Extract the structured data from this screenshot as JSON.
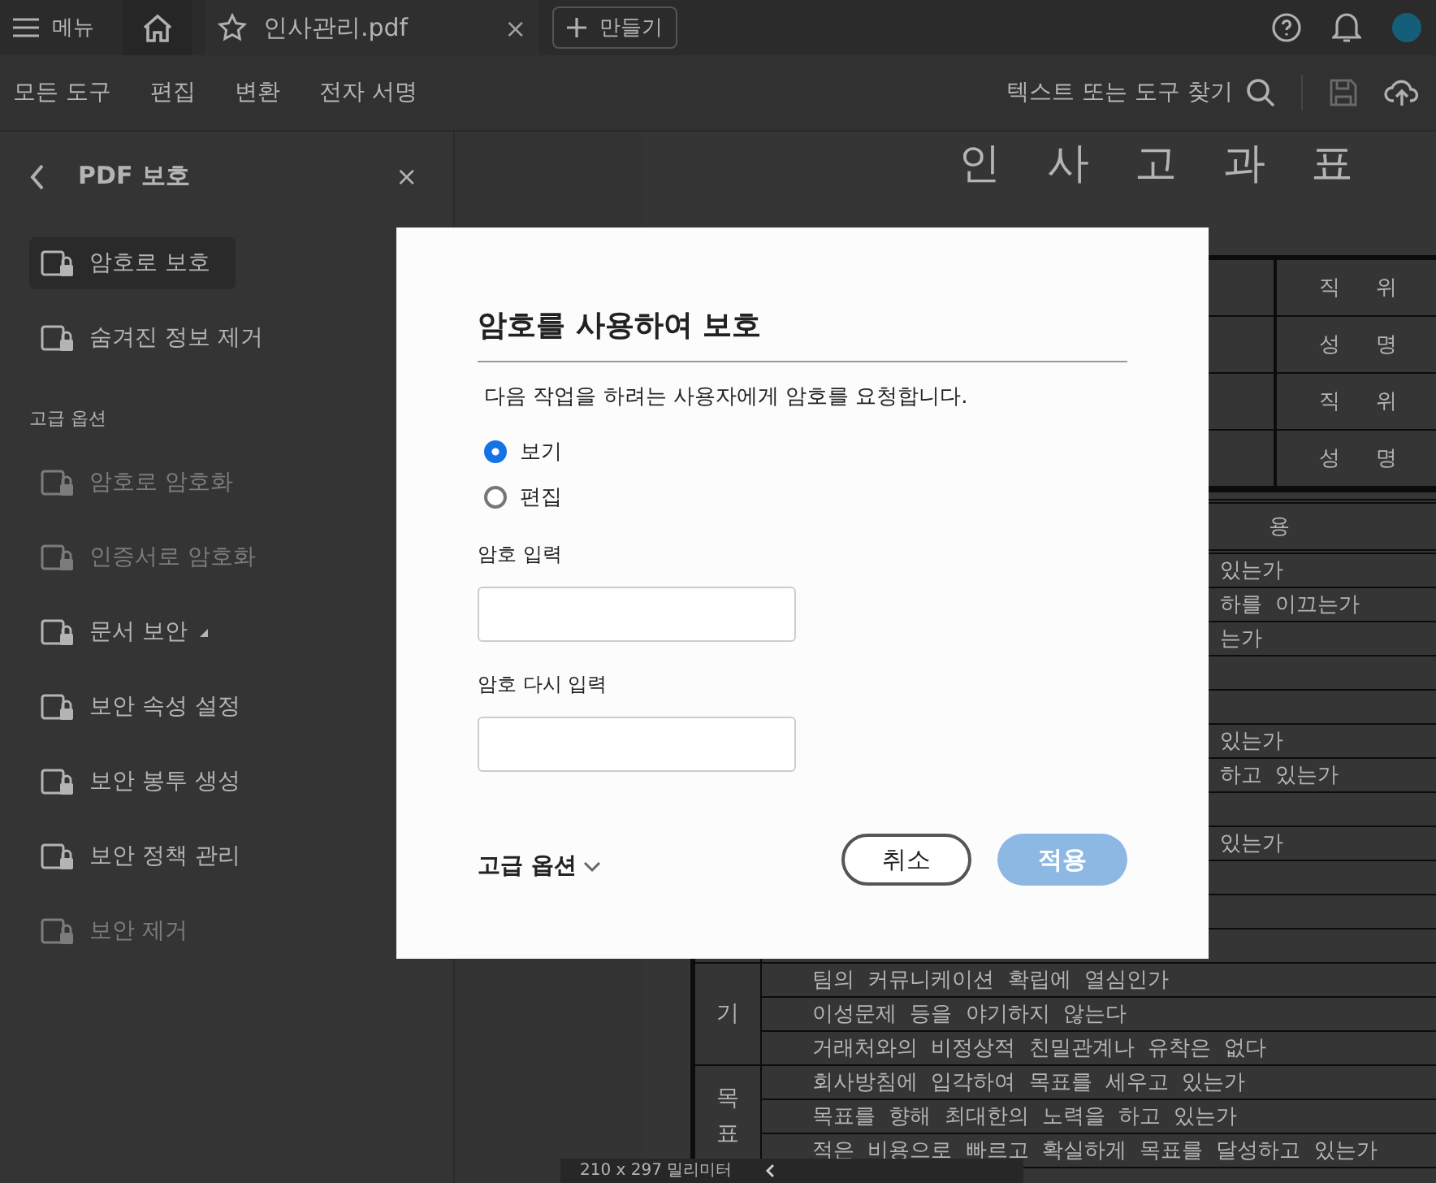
{
  "tab_bar": {
    "menu_label": "메뉴",
    "tab": {
      "label": "인사관리.pdf",
      "close": "×"
    },
    "create_button": "만들기"
  },
  "toolbar": {
    "items": [
      "모든 도구",
      "편집",
      "변환",
      "전자 서명"
    ],
    "search_placeholder": "텍스트 또는 도구 찾기"
  },
  "sidebar": {
    "title": "PDF 보호",
    "close": "×",
    "items": [
      {
        "label": "암호로 보호",
        "selected": true,
        "disabled": false,
        "submenu": false
      },
      {
        "label": "숨겨진 정보 제거",
        "selected": false,
        "disabled": false,
        "submenu": false
      }
    ],
    "section_label": "고급 옵션",
    "advanced_items": [
      {
        "label": "암호로 암호화",
        "selected": false,
        "disabled": true,
        "submenu": false
      },
      {
        "label": "인증서로 암호화",
        "selected": false,
        "disabled": true,
        "submenu": false
      },
      {
        "label": "문서 보안",
        "selected": false,
        "disabled": false,
        "submenu": true
      },
      {
        "label": "보안 속성 설정",
        "selected": false,
        "disabled": false,
        "submenu": false
      },
      {
        "label": "보안 봉투 생성",
        "selected": false,
        "disabled": false,
        "submenu": false
      },
      {
        "label": "보안 정책 관리",
        "selected": false,
        "disabled": false,
        "submenu": false
      },
      {
        "label": "보안 제거",
        "selected": false,
        "disabled": true,
        "submenu": false
      }
    ]
  },
  "document": {
    "title": "인 사 고 과 표",
    "sign_rows": [
      "직 위",
      "성 명",
      "직 위",
      "성 명"
    ],
    "content_header": "용",
    "groups": [
      {
        "rows": [
          {
            "kind": "cut",
            "text": "있는가"
          },
          {
            "kind": "cut",
            "text": "하를 이끄는가"
          },
          {
            "kind": "cut",
            "text": "는가"
          },
          {
            "kind": "cut"
          },
          {
            "kind": "cut"
          },
          {
            "kind": "cut",
            "text": "있는가"
          },
          {
            "kind": "cut",
            "text": "하고 있는가"
          },
          {
            "kind": "cut"
          },
          {
            "kind": "cut",
            "text": "있는가"
          },
          {
            "kind": "cut"
          },
          {
            "kind": "cut"
          },
          {
            "kind": "cut"
          }
        ]
      },
      {
        "category": "기",
        "rows": [
          {
            "kind": "full",
            "text": "팀의 커뮤니케이션 확립에 열심인가"
          },
          {
            "kind": "full",
            "text": "이성문제 등을 야기하지 않는다"
          },
          {
            "kind": "full",
            "text": "거래처와의 비정상적 친밀관계나 유착은 없다"
          }
        ]
      },
      {
        "category": "목표",
        "rows": [
          {
            "kind": "full",
            "text": "회사방침에 입각하여 목표를 세우고 있는가"
          },
          {
            "kind": "full",
            "text": "목표를 향해 최대한의 노력을 하고 있는가"
          },
          {
            "kind": "full",
            "text": "적은 비용으로 빠르고 확실하게 목표를 달성하고 있는가"
          }
        ]
      }
    ],
    "page_size": "210 x 297 밀리미터"
  },
  "dialog": {
    "title": "암호를 사용하여 보호",
    "description": "다음 작업을 하려는 사용자에게 암호를 요청합니다.",
    "options": [
      {
        "label": "보기",
        "selected": true
      },
      {
        "label": "편집",
        "selected": false
      }
    ],
    "fields": [
      {
        "label": "암호 입력"
      },
      {
        "label": "암호 다시 입력"
      }
    ],
    "advanced_link": "고급 옵션",
    "buttons": [
      {
        "label": "취소",
        "kind": "secondary",
        "disabled": false
      },
      {
        "label": "적용",
        "kind": "primary",
        "disabled": true
      }
    ]
  }
}
